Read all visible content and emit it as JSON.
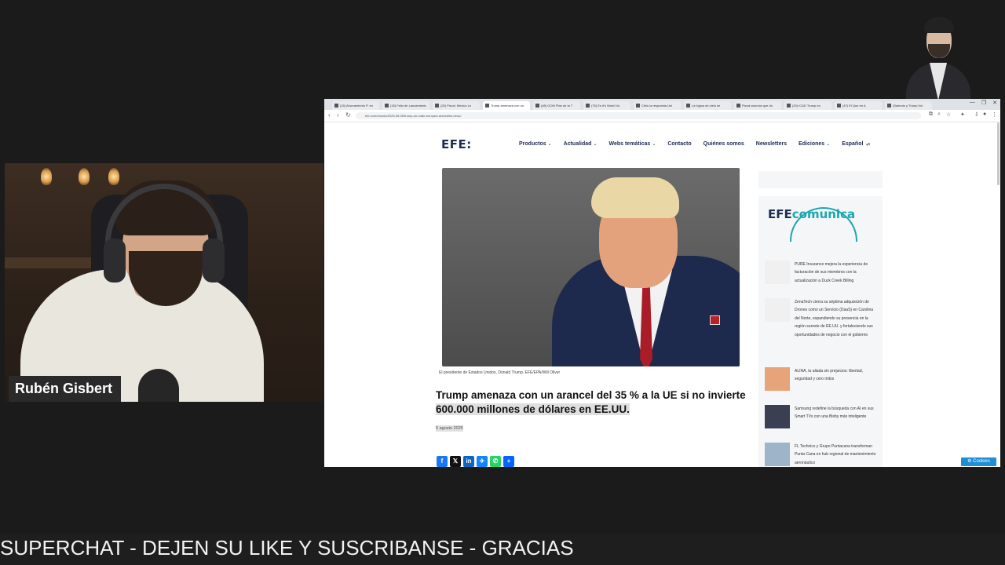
{
  "webcam": {
    "name": "Rubén Gisbert"
  },
  "browser": {
    "tabs": [
      {
        "title": "(15) Ahorramiento P. en"
      },
      {
        "title": "(18) Fallo de Lanzamiento"
      },
      {
        "title": "(20) Fiscal. Mexico Le"
      },
      {
        "title": "Trump amenaza con un",
        "active": true
      },
      {
        "title": "(48) GOM Plan de la T"
      },
      {
        "title": "(76) Es It's World Vo"
      },
      {
        "title": "Cielo la respuesta Uni"
      },
      {
        "title": "La lógica de cielo de"
      },
      {
        "title": "Fiscal anuncia que do"
      },
      {
        "title": "(20) ICAD Trump en"
      },
      {
        "title": "(47) El Que en A"
      },
      {
        "title": "(Salendo y Trump Vot"
      }
    ],
    "window_controls": [
      "—",
      "❐",
      "✕"
    ],
    "url": "efe.com/mundo/2025-08-05/trump-un-crate-europea-aranceles-eeuu/"
  },
  "site": {
    "logo": "EFE:",
    "nav": [
      {
        "label": "Productos",
        "dropdown": true
      },
      {
        "label": "Actualidad",
        "dropdown": true
      },
      {
        "label": "Webs temáticas",
        "dropdown": true
      },
      {
        "label": "Contacto",
        "dropdown": false
      },
      {
        "label": "Quiénes somos",
        "dropdown": false
      },
      {
        "label": "Newsletters",
        "dropdown": false
      },
      {
        "label": "Ediciones",
        "dropdown": true
      },
      {
        "label": "Español",
        "dropdown": true
      }
    ]
  },
  "article": {
    "caption": "El presidente de Estados Unidos, Donald Trump. EFE/EPA/Will Oliver",
    "headline_part1": "Trump amenaza con un arancel del 35 % a la UE si no invierte",
    "headline_part2": "600.000 millones de dólares en EE.UU.",
    "date": "5 agosto 2025",
    "share": [
      {
        "icon": "facebook-icon",
        "glyph": "f",
        "color": "#1877f2"
      },
      {
        "icon": "x-icon",
        "glyph": "𝕏",
        "color": "#111111"
      },
      {
        "icon": "linkedin-icon",
        "glyph": "in",
        "color": "#0a66c2"
      },
      {
        "icon": "bluesky-icon",
        "glyph": "✈",
        "color": "#1185fe"
      },
      {
        "icon": "whatsapp-icon",
        "glyph": "✆",
        "color": "#25d366"
      },
      {
        "icon": "share-plus-icon",
        "glyph": "+",
        "color": "#0166ff"
      }
    ]
  },
  "sidebar": {
    "logo_efe": "EFE",
    "logo_comunica": "comunica",
    "news": [
      {
        "text": "PURE Insurance mejora la experiencia de facturación de sus miembros con la actualización a Duck Creek Billing",
        "thumb": "#f0f0f0"
      },
      {
        "text": "ZenaTech cierra su séptima adquisición de Drones como un Servicio (DaaS) en Carolina del Norte, expandiendo su presencia en la región sureste de EE.UU. y fortaleciendo sus oportunidades de negocio con el gobierno",
        "thumb": "#f0f0f0"
      },
      {
        "text": "ALINA, tu aliada sin prejuicios: libertad, seguridad y cero mitos",
        "thumb": "#e7a37a"
      },
      {
        "text": "Samsung redefine la búsqueda con AI en sus Smart TVs con una Bixby más inteligente",
        "thumb": "#3b3f52"
      },
      {
        "text": "FL Technics y Grupo Puntacana transforman Punta Cana en hub regional de mantenimiento aeronáutico",
        "thumb": "#9db4c9"
      }
    ],
    "cookies": "Cookies"
  },
  "ticker": "SUPERCHAT - DEJEN SU LIKE Y SUSCRIBANSE - GRACIAS"
}
